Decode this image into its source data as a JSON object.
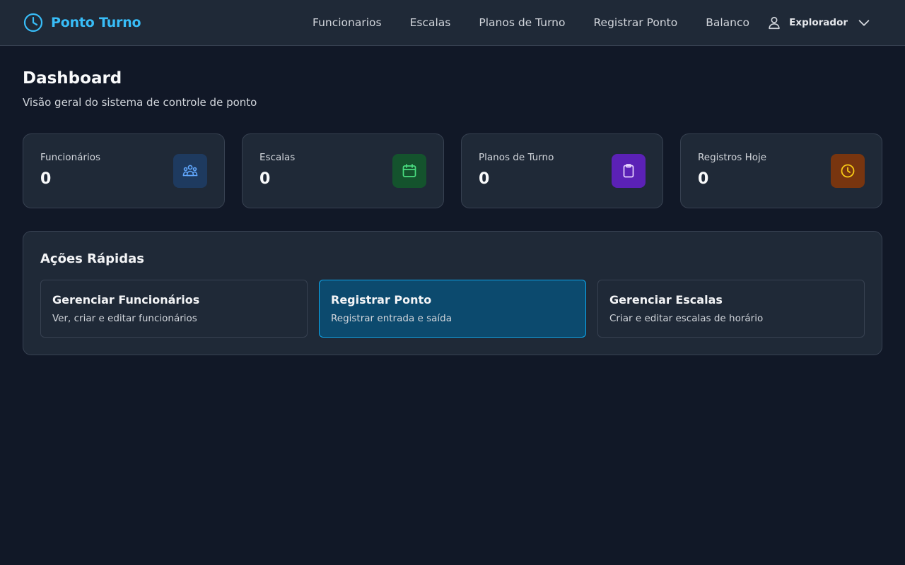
{
  "app": {
    "title": "Ponto Turno",
    "brand_icon": "clock-icon"
  },
  "nav": {
    "links": [
      {
        "label": "Funcionarios"
      },
      {
        "label": "Escalas"
      },
      {
        "label": "Planos de Turno"
      },
      {
        "label": "Registrar Ponto"
      },
      {
        "label": "Balanco"
      }
    ],
    "user": {
      "name": "Explorador",
      "icon": "user-icon",
      "caret": "chevron-down-icon"
    }
  },
  "page": {
    "title": "Dashboard",
    "subtitle": "Visão geral do sistema de controle de ponto"
  },
  "stats": [
    {
      "label": "Funcionários",
      "value": "0",
      "icon": "users-icon",
      "bg": "#1e3a5f",
      "fg": "#60a5fa"
    },
    {
      "label": "Escalas",
      "value": "0",
      "icon": "calendar-icon",
      "bg": "#14532d",
      "fg": "#4ade80"
    },
    {
      "label": "Planos de Turno",
      "value": "0",
      "icon": "clipboard-icon",
      "bg": "#5b21b6",
      "fg": "#e9d5ff"
    },
    {
      "label": "Registros Hoje",
      "value": "0",
      "icon": "clock-icon",
      "bg": "#78350f",
      "fg": "#facc15"
    }
  ],
  "quick_actions": {
    "title": "Ações Rápidas",
    "items": [
      {
        "title": "Gerenciar Funcionários",
        "description": "Ver, criar e editar funcionários",
        "active": false
      },
      {
        "title": "Registrar Ponto",
        "description": "Registrar entrada e saída",
        "active": true
      },
      {
        "title": "Gerenciar Escalas",
        "description": "Criar e editar escalas de horário",
        "active": false
      }
    ]
  },
  "colors": {
    "background": "#111827",
    "surface": "#1f2937",
    "border": "#374151",
    "accent": "#38bdf8",
    "active_card": "#0c4a6e",
    "active_border": "#0ea5e9"
  }
}
